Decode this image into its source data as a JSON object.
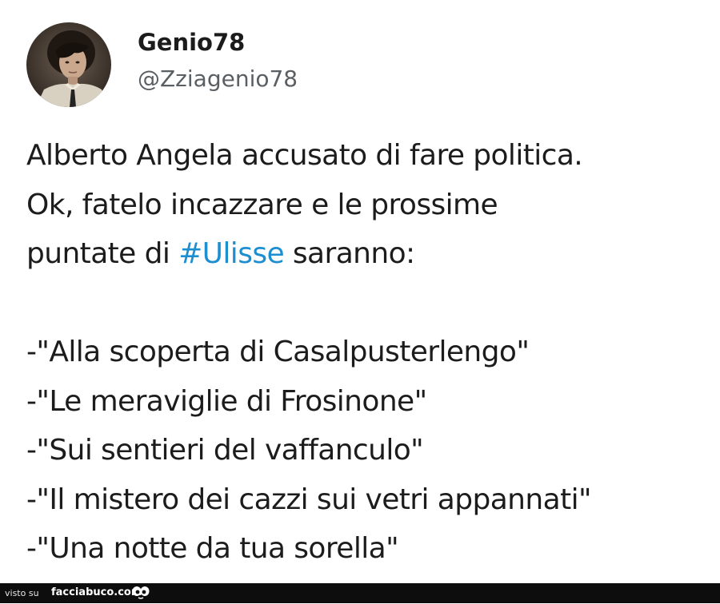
{
  "tweet": {
    "display_name": "Genio78",
    "handle": "@Zziagenio78",
    "text_lines": [
      {
        "text": "Alberto Angela accusato di fare politica."
      },
      {
        "text": "Ok, fatelo incazzare e le prossime"
      },
      {
        "before": "puntate di ",
        "hashtag": "#Ulisse",
        "after": " saranno:"
      },
      {
        "text": "-\"Alla scoperta di Casalpusterlengo\""
      },
      {
        "text": "-\"Le meraviglie di Frosinone\""
      },
      {
        "text": "-\"Sui sentieri del vaffanculo\""
      },
      {
        "text": "-\"Il mistero dei cazzi sui vetri appannati\""
      },
      {
        "text": "-\"Una notte da tua sorella\""
      }
    ],
    "hashtag_color": "#1d8fd0"
  },
  "footer": {
    "prefix": "visto su",
    "site": "facciabuco.com",
    "logo_icon": "eyes-icon"
  }
}
